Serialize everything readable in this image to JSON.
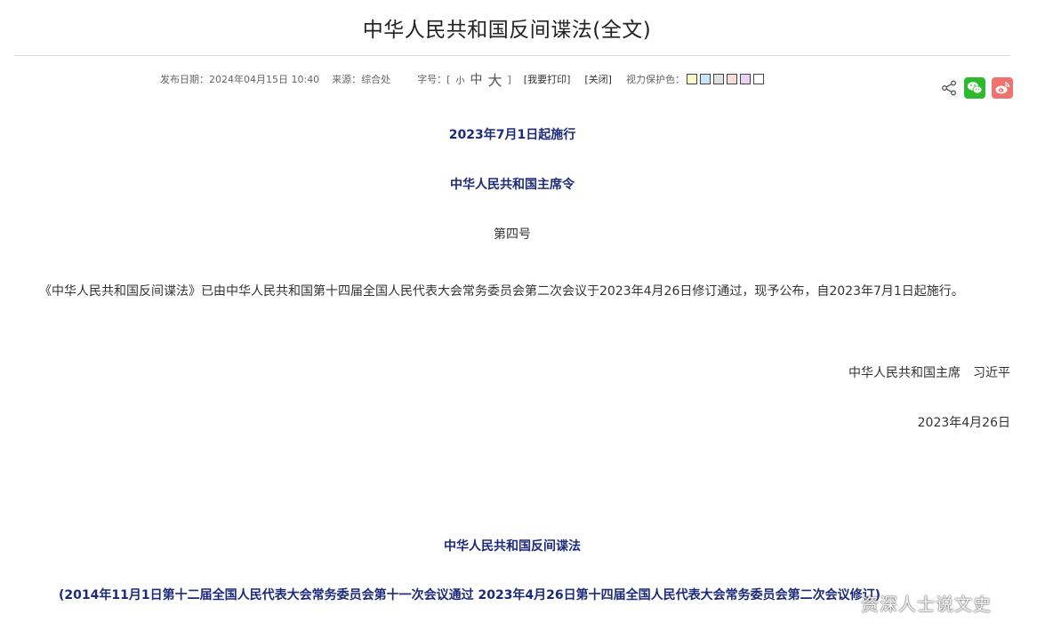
{
  "document": {
    "title": "中华人民共和国反间谍法(全文)"
  },
  "meta": {
    "publish_label": "发布日期：",
    "publish_date": "2024年04月15日 10:40",
    "source_label": "来源：",
    "source": "综合处",
    "font_size_label": "字号：[",
    "font_small": "小",
    "font_medium": "中",
    "font_large": "大",
    "font_size_close": "]",
    "print_link": "[我要打印]",
    "close_link": "[关闭]",
    "eye_protection_label": "视力保护色：",
    "eye_protection_colors": [
      "#fafac8",
      "#c8e6fa",
      "#e0e0e0",
      "#fadcdc",
      "#e6d2f5",
      "#ffffff"
    ]
  },
  "share": {
    "share_icon": "share-icon",
    "wechat_icon": "wechat-icon",
    "weibo_icon": "weibo-icon"
  },
  "content": {
    "effective_date": "2023年7月1日起施行",
    "decree_title": "中华人民共和国主席令",
    "decree_number": "第四号",
    "paragraph": "《中华人民共和国反间谍法》已由中华人民共和国第十四届全国人民代表大会常务委员会第二次会议于2023年4月26日修订通过，现予公布，自2023年7月1日起施行。",
    "signature": "中华人民共和国主席　习近平",
    "sign_date": "2023年4月26日",
    "law_title": "中华人民共和国反间谍法",
    "law_subtitle": "(2014年11月1日第十二届全国人民代表大会常务委员会第十一次会议通过 2023年4月26日第十四届全国人民代表大会常务委员会第二次会议修订)"
  },
  "watermark": "资深人士说文史"
}
